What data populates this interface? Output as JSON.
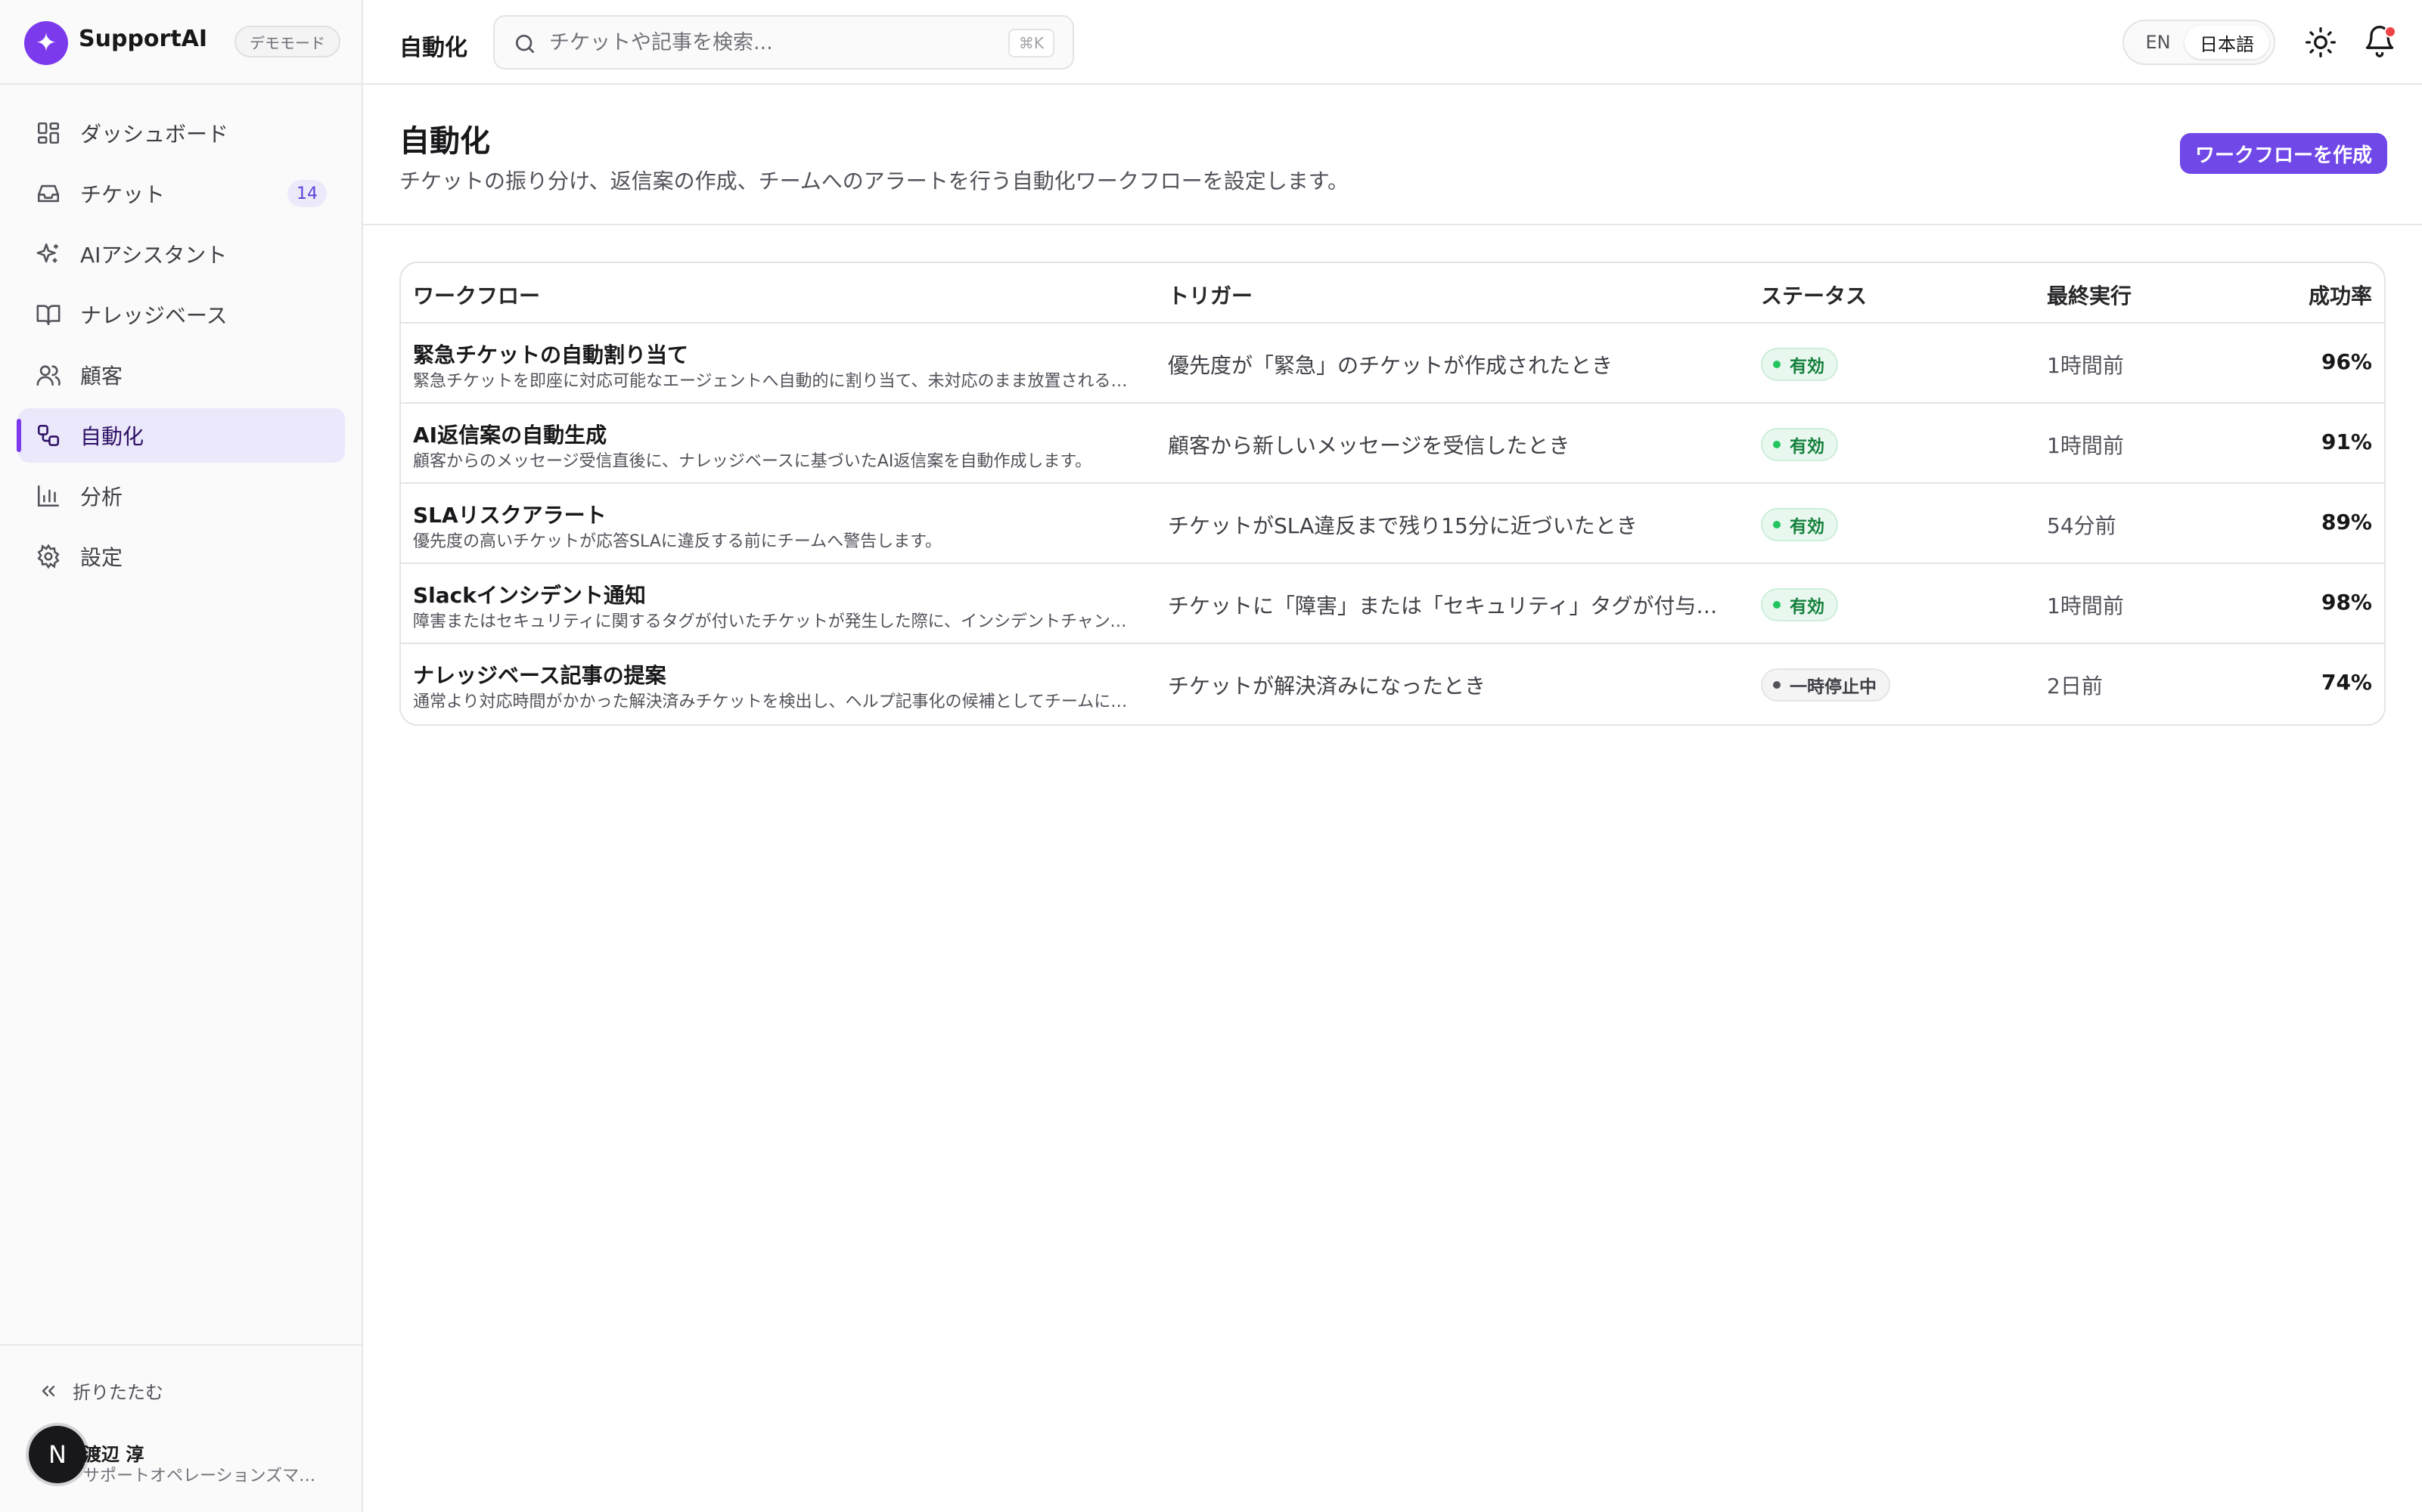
{
  "app": {
    "name": "SupportAI",
    "mode_badge": "デモモード"
  },
  "colors": {
    "accent": "#7148e8",
    "active_status": "#22c55e",
    "paused_status": "#52525b",
    "notification": "#ef4444"
  },
  "sidebar": {
    "items": [
      {
        "label": "ダッシュボード",
        "icon": "dashboard-icon"
      },
      {
        "label": "チケット",
        "icon": "inbox-icon",
        "count": "14"
      },
      {
        "label": "AIアシスタント",
        "icon": "sparkles-icon"
      },
      {
        "label": "ナレッジベース",
        "icon": "book-icon"
      },
      {
        "label": "顧客",
        "icon": "users-icon"
      },
      {
        "label": "自動化",
        "icon": "workflow-icon",
        "active": true
      },
      {
        "label": "分析",
        "icon": "bar-chart-icon"
      },
      {
        "label": "設定",
        "icon": "gear-icon"
      }
    ],
    "collapse_label": "折りたたむ",
    "user": {
      "initial": "N",
      "name": "渡辺 淳",
      "role": "サポートオペレーションズマネージャー"
    }
  },
  "topbar": {
    "breadcrumb": "自動化",
    "search_placeholder": "チケットや記事を検索...",
    "search_shortcut": "⌘K",
    "lang_en": "EN",
    "lang_ja": "日本語"
  },
  "page": {
    "title": "自動化",
    "description": "チケットの振り分け、返信案の作成、チームへのアラートを行う自動化ワークフローを設定します。",
    "create_button": "ワークフローを作成"
  },
  "table": {
    "headers": {
      "workflow": "ワークフロー",
      "trigger": "トリガー",
      "status": "ステータス",
      "last_run": "最終実行",
      "success_rate": "成功率"
    },
    "rows": [
      {
        "name": "緊急チケットの自動割り当て",
        "description": "緊急チケットを即座に対応可能なエージェントへ自動的に割り当て、未対応のまま放置されるのを防ぎます。",
        "trigger": "優先度が「緊急」のチケットが作成されたとき",
        "status": "有効",
        "status_type": "active",
        "last_run": "1時間前",
        "success_rate": "96%"
      },
      {
        "name": "AI返信案の自動生成",
        "description": "顧客からのメッセージ受信直後に、ナレッジベースに基づいたAI返信案を自動作成します。",
        "trigger": "顧客から新しいメッセージを受信したとき",
        "status": "有効",
        "status_type": "active",
        "last_run": "1時間前",
        "success_rate": "91%"
      },
      {
        "name": "SLAリスクアラート",
        "description": "優先度の高いチケットが応答SLAに違反する前にチームへ警告します。",
        "trigger": "チケットがSLA違反まで残り15分に近づいたとき",
        "status": "有効",
        "status_type": "active",
        "last_run": "54分前",
        "success_rate": "89%"
      },
      {
        "name": "Slackインシデント通知",
        "description": "障害またはセキュリティに関するタグが付いたチケットが発生した際に、インシデントチャンネルへ通知します。",
        "trigger": "チケットに「障害」または「セキュリティ」タグが付与されたとき",
        "status": "有効",
        "status_type": "active",
        "last_run": "1時間前",
        "success_rate": "98%"
      },
      {
        "name": "ナレッジベース記事の提案",
        "description": "通常より対応時間がかかった解決済みチケットを検出し、ヘルプ記事化の候補としてチームに提案します。",
        "trigger": "チケットが解決済みになったとき",
        "status": "一時停止中",
        "status_type": "paused",
        "last_run": "2日前",
        "success_rate": "74%"
      }
    ]
  }
}
